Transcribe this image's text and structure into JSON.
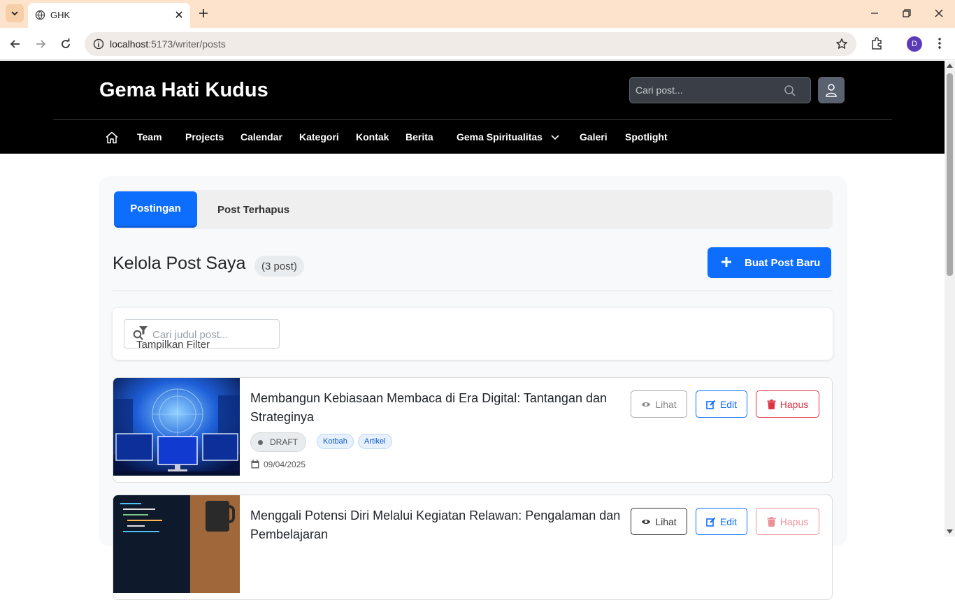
{
  "browser": {
    "tab_title": "GHK",
    "url_host": "localhost",
    "url_rest": ":5173/writer/posts",
    "profile_initial": "D"
  },
  "site": {
    "brand": "Gema Hati Kudus",
    "search_placeholder": "Cari post...",
    "nav": {
      "team": "Team",
      "projects": "Projects",
      "calendar": "Calendar",
      "kategori": "Kategori",
      "kontak": "Kontak",
      "berita": "Berita",
      "spiritualitas": "Gema Spiritualitas",
      "galeri": "Galeri",
      "spotlight": "Spotlight"
    }
  },
  "page": {
    "tabs": {
      "active": "Postingan",
      "inactive": "Post Terhapus"
    },
    "title": "Kelola Post Saya",
    "post_count": "(3 post)",
    "new_post_label": "Buat Post Baru",
    "filter": {
      "placeholder": "Cari judul post...",
      "toggle_label": "Tampilkan Filter"
    },
    "actions": {
      "view": "Lihat",
      "edit": "Edit",
      "delete": "Hapus"
    },
    "posts": [
      {
        "title": "Membangun Kebiasaan Membaca di Era Digital: Tantangan dan Strateginya",
        "status": "DRAFT",
        "categories": [
          "Kotbah",
          "Artikel"
        ],
        "date": "09/04/2025"
      },
      {
        "title": "Menggali Potensi Diri Melalui Kegiatan Relawan: Pengalaman dan Pembelajaran"
      }
    ]
  }
}
